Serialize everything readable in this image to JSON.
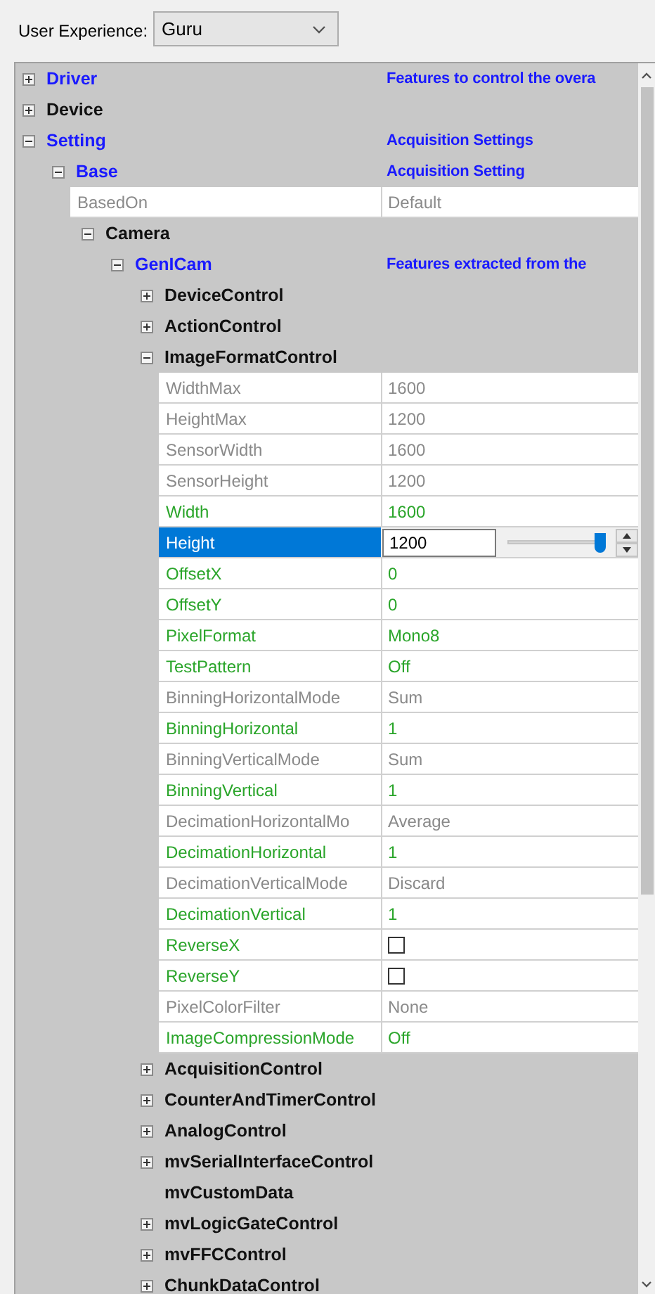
{
  "toolbar": {
    "label": "User Experience:",
    "combo": {
      "value": "Guru"
    }
  },
  "tree": [
    {
      "kind": "category",
      "name": "Driver",
      "expandable": true,
      "expanded": false,
      "color": "#1a1aff",
      "description": "Features to control the overa"
    },
    {
      "kind": "category",
      "name": "Device",
      "expandable": true,
      "expanded": false,
      "color": "#111111"
    },
    {
      "kind": "category",
      "name": "Setting",
      "expandable": true,
      "expanded": true,
      "color": "#1a1aff",
      "description": "Acquisition Settings",
      "children": [
        {
          "kind": "category",
          "name": "Base",
          "expandable": true,
          "expanded": true,
          "color": "#1a1aff",
          "description": "Acquisition Setting",
          "children": [
            {
              "kind": "field",
              "name": "BasedOn",
              "value": "Default",
              "writable": false,
              "selected": false
            },
            {
              "kind": "category",
              "name": "Camera",
              "expandable": true,
              "expanded": true,
              "color": "#111111",
              "children": [
                {
                  "kind": "category",
                  "name": "GenICam",
                  "expandable": true,
                  "expanded": true,
                  "color": "#1a1aff",
                  "description": "Features extracted from the",
                  "children": [
                    {
                      "kind": "category",
                      "name": "DeviceControl",
                      "expandable": true,
                      "expanded": false,
                      "color": "#111111"
                    },
                    {
                      "kind": "category",
                      "name": "ActionControl",
                      "expandable": true,
                      "expanded": false,
                      "color": "#111111"
                    },
                    {
                      "kind": "category",
                      "name": "ImageFormatControl",
                      "expandable": true,
                      "expanded": true,
                      "color": "#111111",
                      "children": [
                        {
                          "kind": "field",
                          "name": "WidthMax",
                          "value": "1600",
                          "writable": false,
                          "selected": false
                        },
                        {
                          "kind": "field",
                          "name": "HeightMax",
                          "value": "1200",
                          "writable": false,
                          "selected": false
                        },
                        {
                          "kind": "field",
                          "name": "SensorWidth",
                          "value": "1600",
                          "writable": false,
                          "selected": false
                        },
                        {
                          "kind": "field",
                          "name": "SensorHeight",
                          "value": "1200",
                          "writable": false,
                          "selected": false
                        },
                        {
                          "kind": "field",
                          "name": "Width",
                          "value": "1600",
                          "writable": true,
                          "selected": false
                        },
                        {
                          "kind": "slider",
                          "name": "Height",
                          "value": "1200",
                          "writable": true,
                          "selected": true,
                          "level": 1
                        },
                        {
                          "kind": "field",
                          "name": "OffsetX",
                          "value": "0",
                          "writable": true,
                          "selected": false
                        },
                        {
                          "kind": "field",
                          "name": "OffsetY",
                          "value": "0",
                          "writable": true,
                          "selected": false
                        },
                        {
                          "kind": "field",
                          "name": "PixelFormat",
                          "value": "Mono8",
                          "writable": true,
                          "selected": false
                        },
                        {
                          "kind": "field",
                          "name": "TestPattern",
                          "value": "Off",
                          "writable": true,
                          "selected": false
                        },
                        {
                          "kind": "field",
                          "name": "BinningHorizontalMode",
                          "value": "Sum",
                          "writable": false,
                          "selected": false
                        },
                        {
                          "kind": "field",
                          "name": "BinningHorizontal",
                          "value": "1",
                          "writable": true,
                          "selected": false
                        },
                        {
                          "kind": "field",
                          "name": "BinningVerticalMode",
                          "value": "Sum",
                          "writable": false,
                          "selected": false
                        },
                        {
                          "kind": "field",
                          "name": "BinningVertical",
                          "value": "1",
                          "writable": true,
                          "selected": false
                        },
                        {
                          "kind": "field",
                          "name": "DecimationHorizontalMo",
                          "value": "Average",
                          "writable": false,
                          "selected": false
                        },
                        {
                          "kind": "field",
                          "name": "DecimationHorizontal",
                          "value": "1",
                          "writable": true,
                          "selected": false
                        },
                        {
                          "kind": "field",
                          "name": "DecimationVerticalMode",
                          "value": "Discard",
                          "writable": false,
                          "selected": false
                        },
                        {
                          "kind": "field",
                          "name": "DecimationVertical",
                          "value": "1",
                          "writable": true,
                          "selected": false
                        },
                        {
                          "kind": "checkbox",
                          "name": "ReverseX",
                          "checked": false,
                          "writable": true,
                          "selected": false
                        },
                        {
                          "kind": "checkbox",
                          "name": "ReverseY",
                          "checked": false,
                          "writable": true,
                          "selected": false
                        },
                        {
                          "kind": "field",
                          "name": "PixelColorFilter",
                          "value": "None",
                          "writable": false,
                          "selected": false
                        },
                        {
                          "kind": "field",
                          "name": "ImageCompressionMode",
                          "value": "Off",
                          "writable": true,
                          "selected": false
                        }
                      ]
                    },
                    {
                      "kind": "category",
                      "name": "AcquisitionControl",
                      "expandable": true,
                      "expanded": false,
                      "color": "#111111"
                    },
                    {
                      "kind": "category",
                      "name": "CounterAndTimerControl",
                      "expandable": true,
                      "expanded": false,
                      "color": "#111111"
                    },
                    {
                      "kind": "category",
                      "name": "AnalogControl",
                      "expandable": true,
                      "expanded": false,
                      "color": "#111111"
                    },
                    {
                      "kind": "category",
                      "name": "mvSerialInterfaceControl",
                      "expandable": true,
                      "expanded": false,
                      "color": "#111111"
                    },
                    {
                      "kind": "category",
                      "name": "mvCustomData",
                      "expandable": false,
                      "color": "#111111"
                    },
                    {
                      "kind": "category",
                      "name": "mvLogicGateControl",
                      "expandable": true,
                      "expanded": false,
                      "color": "#111111"
                    },
                    {
                      "kind": "category",
                      "name": "mvFFCControl",
                      "expandable": true,
                      "expanded": false,
                      "color": "#111111"
                    },
                    {
                      "kind": "category",
                      "name": "ChunkDataControl",
                      "expandable": true,
                      "expanded": false,
                      "color": "#111111"
                    }
                  ]
                }
              ]
            }
          ]
        }
      ]
    }
  ]
}
